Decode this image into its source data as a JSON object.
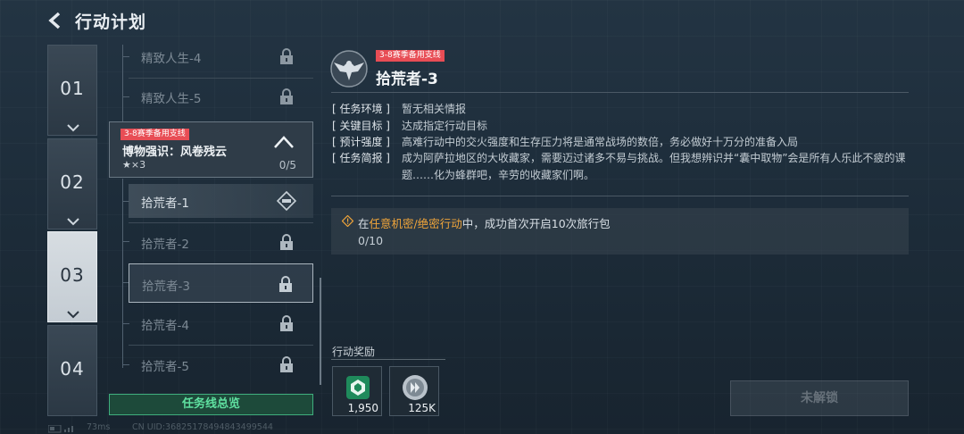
{
  "header": {
    "title": "行动计划"
  },
  "chapters": [
    {
      "num": "01",
      "active": false
    },
    {
      "num": "02",
      "active": false
    },
    {
      "num": "03",
      "active": true
    },
    {
      "num": "04",
      "active": false
    }
  ],
  "missions_above": [
    {
      "label": "精致人生-4"
    },
    {
      "label": "精致人生-5"
    }
  ],
  "group": {
    "tag": "3-8赛季备用支线",
    "name": "博物强识：风卷残云",
    "stars": "★×3",
    "progress": "0/5"
  },
  "missions": [
    {
      "label": "拾荒者-1",
      "icon": "diamond-ticket-icon"
    },
    {
      "label": "拾荒者-2",
      "icon": "lock-icon"
    },
    {
      "label": "拾荒者-3",
      "icon": "lock-icon"
    },
    {
      "label": "拾荒者-4",
      "icon": "lock-icon"
    },
    {
      "label": "拾荒者-5",
      "icon": "lock-icon"
    }
  ],
  "overview_button": "任务线总览",
  "detail": {
    "tag": "3-8赛季备用支线",
    "title": "拾荒者-3",
    "rows": [
      {
        "key": "[ 任务环境 ]",
        "value": "暂无相关情报"
      },
      {
        "key": "[ 关键目标 ]",
        "value": "达成指定行动目标"
      },
      {
        "key": "[ 预计强度 ]",
        "value": "高难行动中的交火强度和生存压力将是通常战场的数倍，务必做好十万分的准备入局"
      },
      {
        "key": "[ 任务简报 ]",
        "value": "成为阿萨拉地区的大收藏家，需要迈过诸多不易与挑战。但我想辨识并“囊中取物”会是所有人乐此不疲的课题……化为蜂群吧，辛劳的收藏家们啊。"
      }
    ],
    "goal": {
      "pre": "在",
      "highlight": "任意机密/绝密行动",
      "post": "中，成功首次开启10次旅行包",
      "progress": "0/10"
    }
  },
  "rewards": {
    "title": "行动奖励",
    "items": [
      {
        "count": "1,950",
        "icon": "experience-badge-icon"
      },
      {
        "count": "125K",
        "icon": "coin-icon"
      }
    ]
  },
  "unlock_button": "未解锁",
  "status": {
    "ping": "73ms",
    "uid": "CN UID:36825178494843499544"
  },
  "colors": {
    "accent_green": "#3fae7d",
    "tag_red": "#e84d55",
    "highlight_orange": "#f0a53a"
  }
}
